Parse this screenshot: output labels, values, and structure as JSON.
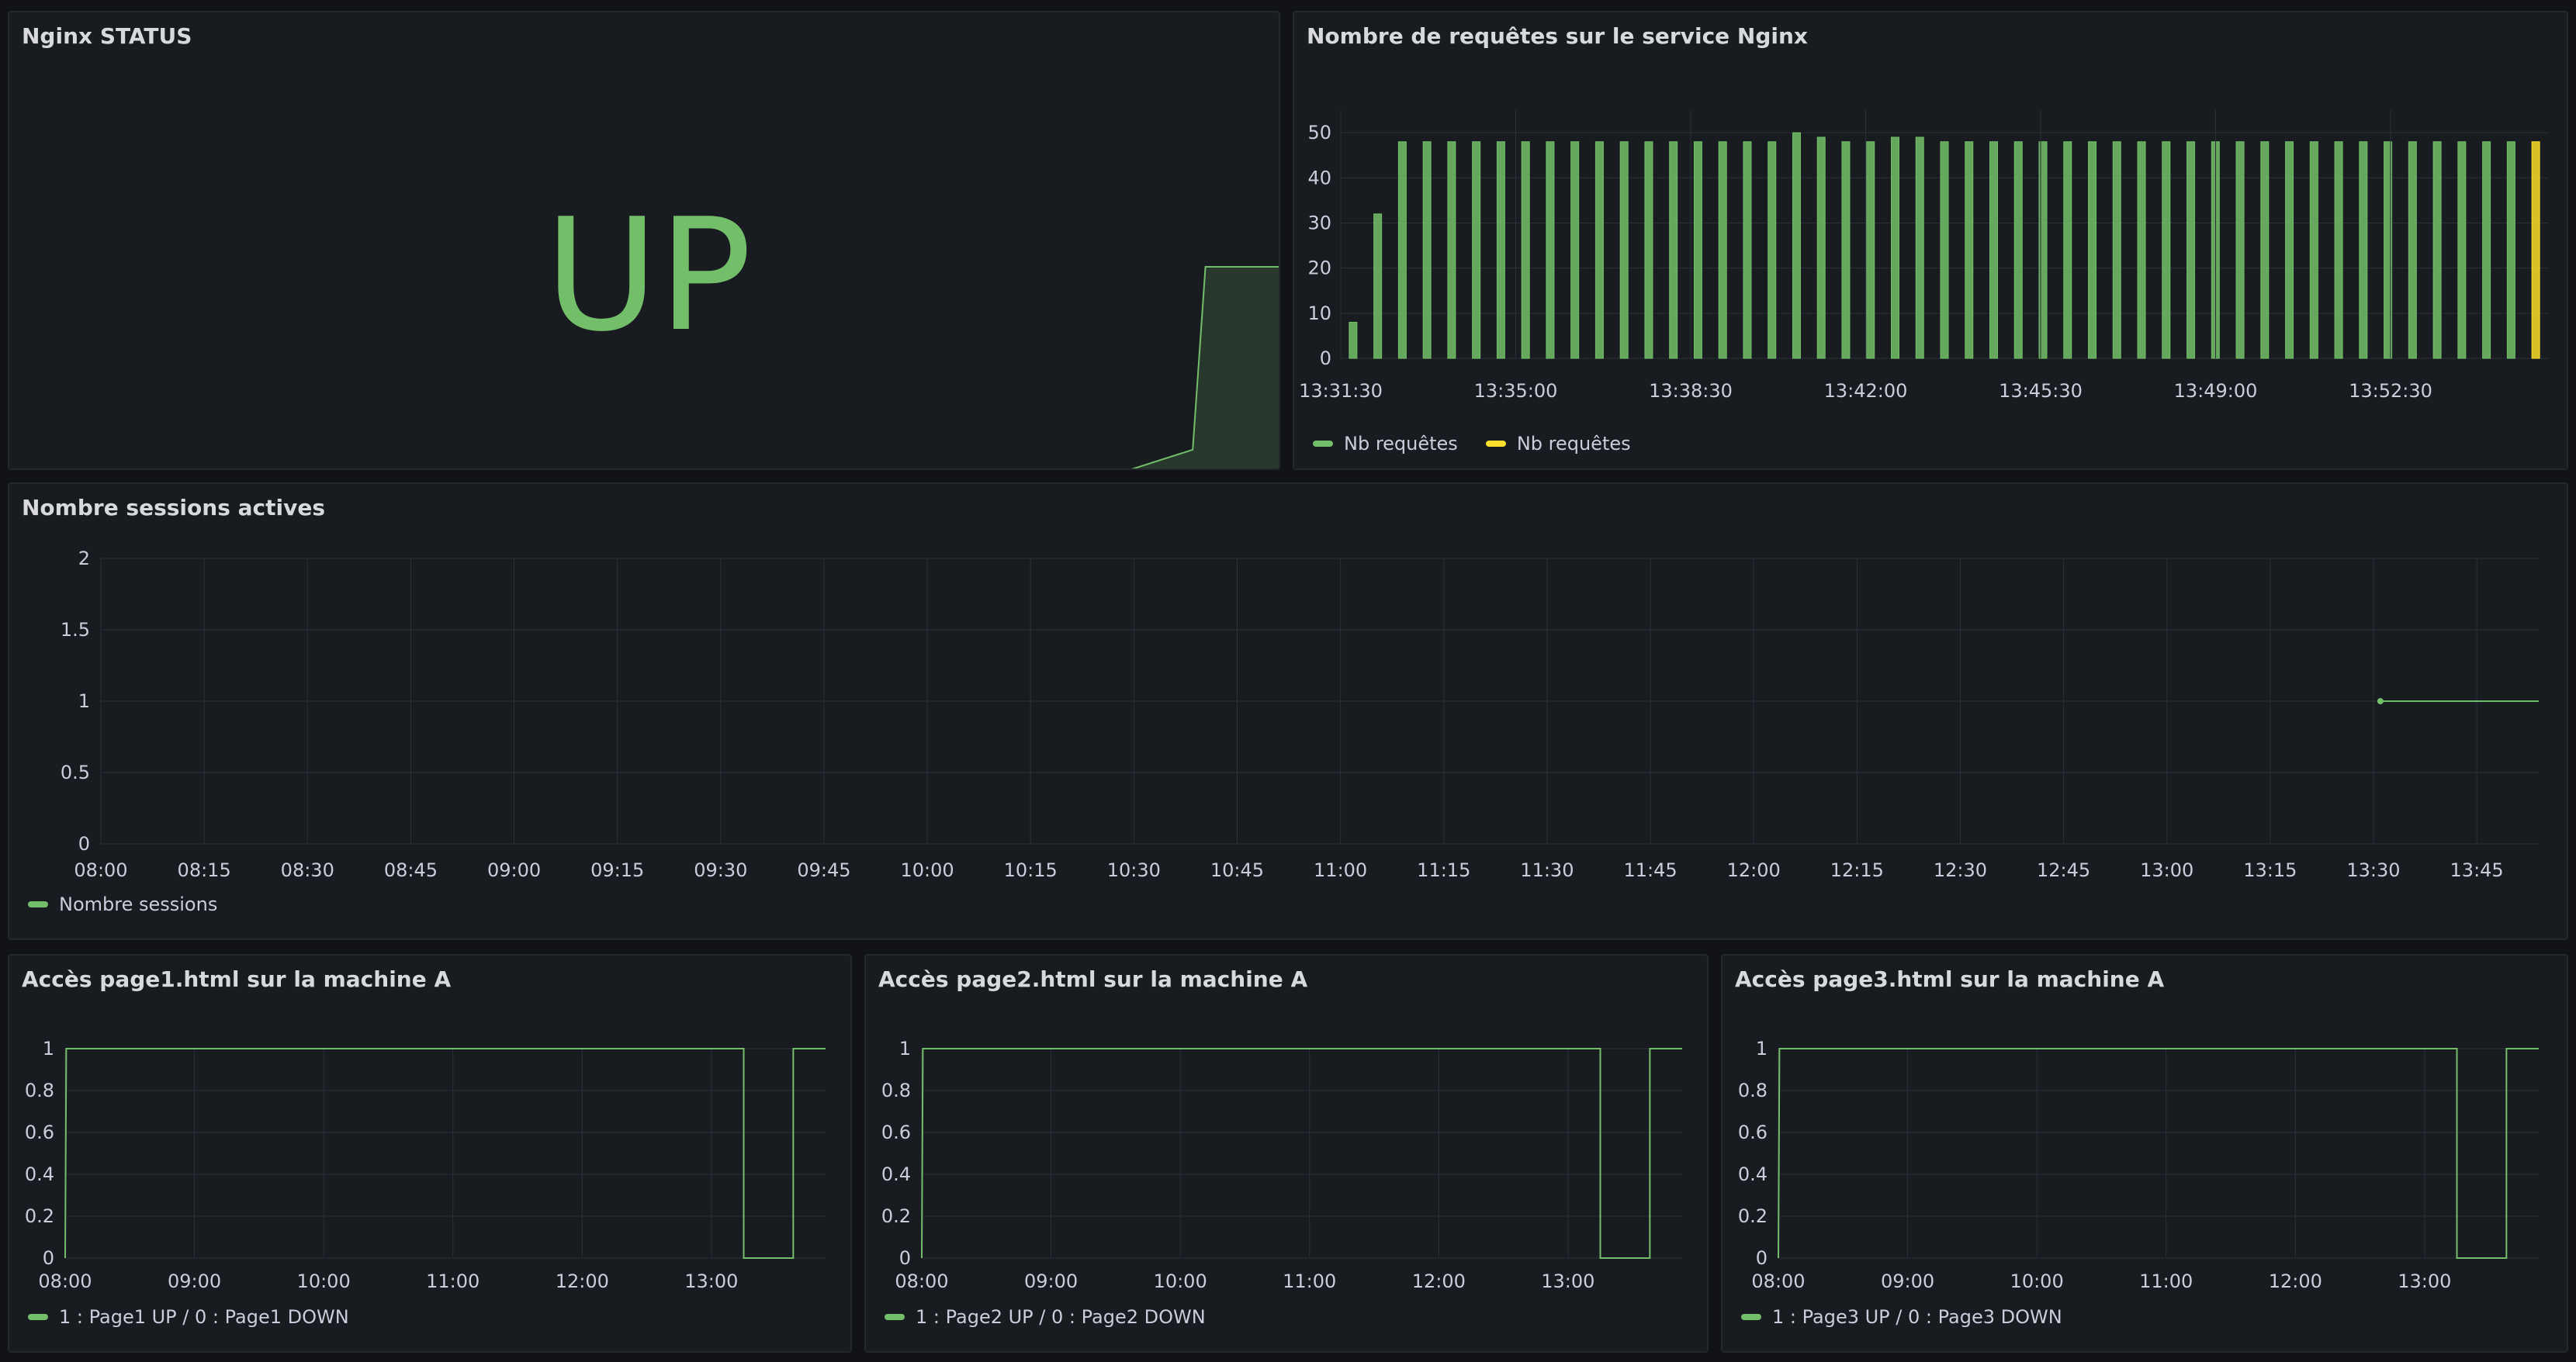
{
  "colors": {
    "background": "#111217",
    "panel": "#181b1f",
    "green": "#73bf69",
    "yellow": "#fade2a",
    "grid": "#2c3038"
  },
  "status_panel": {
    "title": "Nginx STATUS",
    "value": "UP",
    "value_color": "#73bf69"
  },
  "requests_panel": {
    "title": "Nombre de requêtes sur le service Nginx",
    "legend": [
      "Nb requêtes",
      "Nb requêtes"
    ]
  },
  "sessions_panel": {
    "title": "Nombre sessions actives",
    "legend": [
      "Nombre sessions"
    ]
  },
  "page_panels": [
    {
      "title": "Accès page1.html sur la machine A",
      "legend": "1 : Page1 UP / 0 : Page1 DOWN"
    },
    {
      "title": "Accès page2.html sur la machine A",
      "legend": "1 : Page2 UP / 0 : Page2 DOWN"
    },
    {
      "title": "Accès page3.html sur la machine A",
      "legend": "1 : Page3 UP / 0 : Page3 DOWN"
    }
  ],
  "chart_data": [
    {
      "type": "stat",
      "value": "UP",
      "sparkline": {
        "min": 0,
        "max": 1,
        "points": [
          [
            0,
            0
          ],
          [
            0.88,
            0
          ],
          [
            0.93,
            0.1
          ],
          [
            0.94,
            1
          ],
          [
            1,
            1
          ]
        ]
      }
    },
    {
      "type": "bar",
      "x_ticks": [
        "13:31:30",
        "13:35:00",
        "13:38:30",
        "13:42:00",
        "13:45:30",
        "13:49:00",
        "13:52:30"
      ],
      "y_ticks": [
        0,
        10,
        20,
        30,
        40,
        50
      ],
      "ylim": [
        0,
        55
      ],
      "series": [
        {
          "name": "Nb requêtes",
          "color": "#73bf69",
          "values": [
            8,
            32,
            48,
            48,
            48,
            48,
            48,
            48,
            48,
            48,
            48,
            48,
            48,
            48,
            48,
            48,
            48,
            48,
            50,
            49,
            48,
            48,
            49,
            49,
            48,
            48,
            48,
            48,
            48,
            48,
            48,
            48,
            48,
            48,
            48,
            48,
            48,
            48,
            48,
            48,
            48,
            48,
            48,
            48,
            48,
            48,
            48,
            48
          ]
        },
        {
          "name": "Nb requêtes",
          "color": "#fade2a",
          "values": [
            48
          ]
        }
      ]
    },
    {
      "type": "line",
      "x_ticks": [
        "08:00",
        "08:15",
        "08:30",
        "08:45",
        "09:00",
        "09:15",
        "09:30",
        "09:45",
        "10:00",
        "10:15",
        "10:30",
        "10:45",
        "11:00",
        "11:15",
        "11:30",
        "11:45",
        "12:00",
        "12:15",
        "12:30",
        "12:45",
        "13:00",
        "13:15",
        "13:30",
        "13:45"
      ],
      "y_ticks": [
        "0",
        "0.5",
        "1",
        "1.5",
        "2"
      ],
      "xlim_minutes": [
        0,
        354
      ],
      "ylim": [
        0,
        2
      ],
      "series": [
        {
          "name": "Nombre sessions",
          "points": [
            [
              331,
              1
            ],
            [
              354,
              1
            ]
          ]
        }
      ]
    },
    {
      "type": "line",
      "x_ticks": [
        "08:00",
        "09:00",
        "10:00",
        "11:00",
        "12:00",
        "13:00"
      ],
      "y_ticks": [
        "0",
        "0.2",
        "0.4",
        "0.6",
        "0.8",
        "1"
      ],
      "xlim_minutes": [
        0,
        353
      ],
      "ylim": [
        0,
        1
      ],
      "series": [
        {
          "name": "1 : Page1 UP / 0 : Page1 DOWN",
          "points": [
            [
              0,
              0
            ],
            [
              0.5,
              1
            ],
            [
              2,
              1
            ],
            [
              315,
              1
            ],
            [
              315,
              0
            ],
            [
              338,
              0
            ],
            [
              338,
              1
            ],
            [
              353,
              1
            ]
          ]
        }
      ]
    },
    {
      "type": "line",
      "x_ticks": [
        "08:00",
        "09:00",
        "10:00",
        "11:00",
        "12:00",
        "13:00"
      ],
      "y_ticks": [
        "0",
        "0.2",
        "0.4",
        "0.6",
        "0.8",
        "1"
      ],
      "xlim_minutes": [
        0,
        353
      ],
      "ylim": [
        0,
        1
      ],
      "series": [
        {
          "name": "1 : Page2 UP / 0 : Page2 DOWN",
          "points": [
            [
              0,
              0
            ],
            [
              0.5,
              1
            ],
            [
              2,
              1
            ],
            [
              315,
              1
            ],
            [
              315,
              0
            ],
            [
              338,
              0
            ],
            [
              338,
              1
            ],
            [
              353,
              1
            ]
          ]
        }
      ]
    },
    {
      "type": "line",
      "x_ticks": [
        "08:00",
        "09:00",
        "10:00",
        "11:00",
        "12:00",
        "13:00"
      ],
      "y_ticks": [
        "0",
        "0.2",
        "0.4",
        "0.6",
        "0.8",
        "1"
      ],
      "xlim_minutes": [
        0,
        353
      ],
      "ylim": [
        0,
        1
      ],
      "series": [
        {
          "name": "1 : Page3 UP / 0 : Page3 DOWN",
          "points": [
            [
              0,
              0
            ],
            [
              0.5,
              1
            ],
            [
              2,
              1
            ],
            [
              315,
              1
            ],
            [
              315,
              0
            ],
            [
              338,
              0
            ],
            [
              338,
              1
            ],
            [
              353,
              1
            ]
          ]
        }
      ]
    }
  ]
}
